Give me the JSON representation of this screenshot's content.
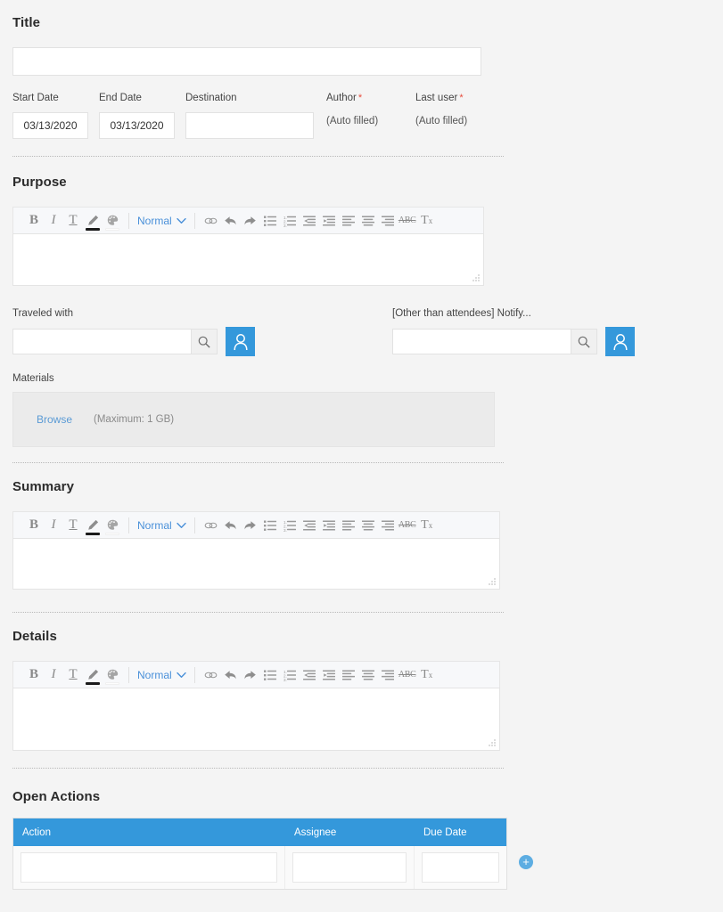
{
  "form": {
    "title_section": {
      "label": "Title",
      "value": "",
      "placeholder": ""
    },
    "meta_fields": [
      {
        "label": "Start Date",
        "value": "03/13/2020",
        "required": false,
        "type": "date"
      },
      {
        "label": "End Date",
        "value": "03/13/2020",
        "required": false,
        "type": "date"
      },
      {
        "label": "Destination",
        "value": "",
        "required": false,
        "type": "text"
      },
      {
        "label": "Author",
        "value": "(Auto filled)",
        "required": true,
        "type": "auto"
      },
      {
        "label": "Last user",
        "value": "(Auto filled)",
        "required": true,
        "type": "auto"
      }
    ],
    "required_marker": "*",
    "purpose": {
      "heading": "Purpose",
      "content": ""
    },
    "summary": {
      "heading": "Summary",
      "content": ""
    },
    "details": {
      "heading": "Details",
      "content": ""
    },
    "traveled_with": {
      "label": "Traveled with",
      "value": "",
      "search_icon": "search-icon",
      "person_icon": "person-picker-icon"
    },
    "notify": {
      "label": "[Other than attendees] Notify...",
      "value": "",
      "search_icon": "search-icon",
      "person_icon": "person-picker-icon"
    },
    "materials": {
      "label": "Materials",
      "browse_label": "Browse",
      "max_note": "(Maximum: 1 GB)"
    },
    "open_actions": {
      "heading": "Open Actions",
      "columns": [
        "Action",
        "Assignee",
        "Due Date"
      ],
      "rows": [
        {
          "action": "",
          "assignee": "",
          "due_date": ""
        }
      ],
      "add_label": "+"
    }
  },
  "editor_toolbar": {
    "style_label": "Normal",
    "buttons": [
      {
        "name": "bold-icon",
        "glyph": "B"
      },
      {
        "name": "italic-icon",
        "glyph": "I"
      },
      {
        "name": "underline-icon",
        "glyph": "T"
      },
      {
        "name": "text-color-pencil-icon",
        "glyph": "pencil"
      },
      {
        "name": "highlight-palette-icon",
        "glyph": "palette"
      },
      {
        "name": "link-icon",
        "glyph": "link"
      },
      {
        "name": "undo-icon",
        "glyph": "undo"
      },
      {
        "name": "redo-icon",
        "glyph": "redo"
      },
      {
        "name": "bullet-list-icon",
        "glyph": "ul"
      },
      {
        "name": "numbered-list-icon",
        "glyph": "ol"
      },
      {
        "name": "outdent-icon",
        "glyph": "outdent"
      },
      {
        "name": "indent-icon",
        "glyph": "indent"
      },
      {
        "name": "align-left-icon",
        "glyph": "align-left"
      },
      {
        "name": "align-center-icon",
        "glyph": "align-center"
      },
      {
        "name": "align-right-icon",
        "glyph": "align-right"
      },
      {
        "name": "strikethrough-icon",
        "glyph": "ABC"
      },
      {
        "name": "clear-format-icon",
        "glyph": "Tx"
      }
    ]
  },
  "colors": {
    "page_background": "#f4f4f4",
    "accent_blue": "#3498db",
    "link_blue": "#5b9bd5",
    "toolbar_blue": "#4a90d9",
    "required_red": "#e74c3c",
    "add_button_blue": "#5dade2",
    "input_border": "#e2e2e2",
    "materials_background": "#ebebeb"
  }
}
